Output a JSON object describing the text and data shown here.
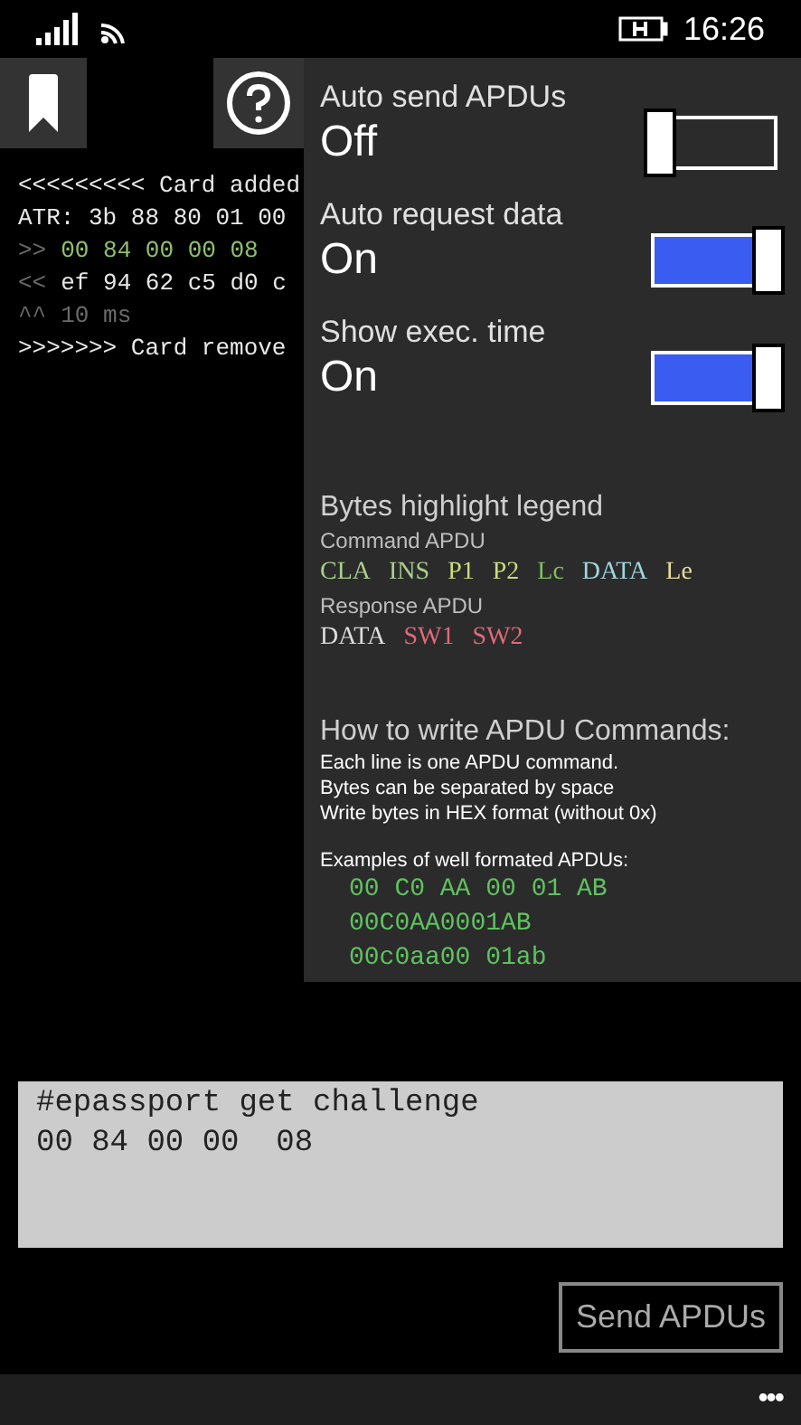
{
  "status_bar": {
    "time": "16:26"
  },
  "log": [
    {
      "kind": "event",
      "text": "<<<<<<<<< Card added"
    },
    {
      "kind": "event",
      "text": "ATR: 3b 88 80 01 00"
    },
    {
      "kind": "command",
      "prefix": ">>",
      "text": "00 84 00 00 08"
    },
    {
      "kind": "response",
      "prefix": "<<",
      "text": "ef 94 62 c5 d0 c"
    },
    {
      "kind": "timing",
      "prefix": "^^",
      "text": "10 ms"
    },
    {
      "kind": "event",
      "text": ">>>>>>> Card remove"
    }
  ],
  "settings_panel": {
    "toggles": [
      {
        "label": "Auto send APDUs",
        "value": "Off",
        "on": false
      },
      {
        "label": "Auto request data",
        "value": "On",
        "on": true
      },
      {
        "label": "Show exec. time",
        "value": "On",
        "on": true
      }
    ],
    "legend_title": "Bytes highlight legend",
    "legend_groups": [
      {
        "title": "Command APDU",
        "items": [
          {
            "text": "CLA",
            "color": "#a8d08d"
          },
          {
            "text": "INS",
            "color": "#a8d08d"
          },
          {
            "text": "P1",
            "color": "#c9dc7e"
          },
          {
            "text": "P2",
            "color": "#c9dc7e"
          },
          {
            "text": "Lc",
            "color": "#7fbf5a"
          },
          {
            "text": "DATA",
            "color": "#9fd6dc"
          },
          {
            "text": "Le",
            "color": "#e6dc9a"
          }
        ]
      },
      {
        "title": "Response APDU",
        "items": [
          {
            "text": "DATA",
            "color": "#dcdcdc"
          },
          {
            "text": "SW1",
            "color": "#e06a7c"
          },
          {
            "text": "SW2",
            "color": "#e06a7c"
          }
        ]
      }
    ],
    "howto_title": "How to write APDU Commands:",
    "howto_lines": [
      "Each line is one APDU command.",
      "Bytes can be separated by space",
      "Write bytes in HEX format (without 0x)"
    ],
    "examples_title": "Examples of well formated APDUs:",
    "examples": [
      "00 C0 AA 00 01 AB",
      "00C0AA0001AB",
      "00c0aa00 01ab"
    ]
  },
  "editor": {
    "lines": [
      "#epassport get challenge",
      "00 84 00 00  08"
    ]
  },
  "send_button": "Send APDUs",
  "app_bar": {
    "more": "•••"
  }
}
